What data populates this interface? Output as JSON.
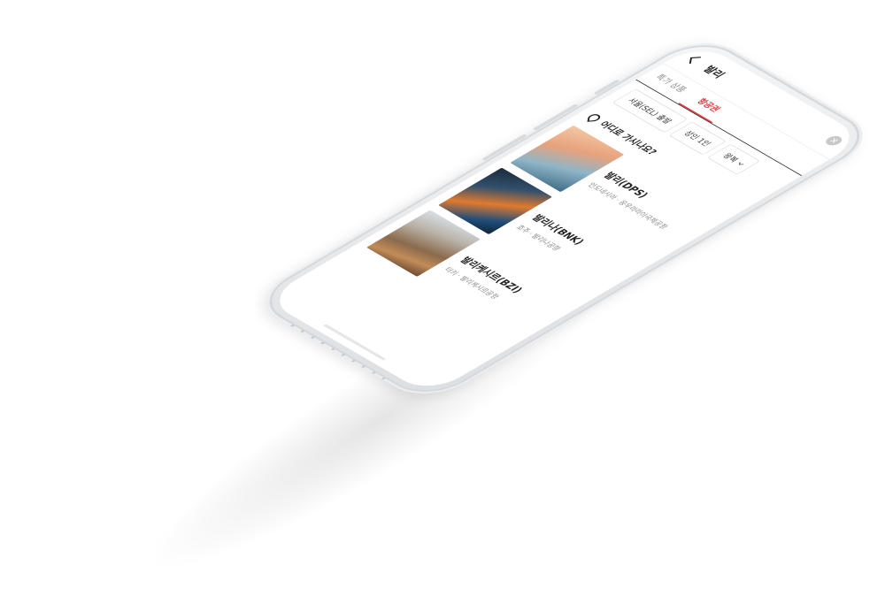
{
  "header": {
    "title": "발리",
    "close_icon": "✕"
  },
  "tabs": [
    {
      "label": "특가 상품",
      "active": false
    },
    {
      "label": "항공권",
      "active": true
    }
  ],
  "filters": {
    "origin": "서울(SEL) 출발",
    "passengers": "성인 1인",
    "trip_type": "왕복"
  },
  "question": "어디로 가시나요?",
  "destinations": [
    {
      "name": "발리(DPS)",
      "sub": "인도네시아 · 응우라라이국제공항",
      "image_icon": "bali-sunset-photo"
    },
    {
      "name": "발리나(BNK)",
      "sub": "호주 · 발리나공항",
      "image_icon": "ballina-night-photo"
    },
    {
      "name": "발리케시르(BZI)",
      "sub": "터키 · 발리케시르공항",
      "image_icon": "balikesir-city-photo"
    }
  ],
  "colors": {
    "accent": "#e8343b",
    "text": "#222222",
    "muted": "#888888"
  }
}
